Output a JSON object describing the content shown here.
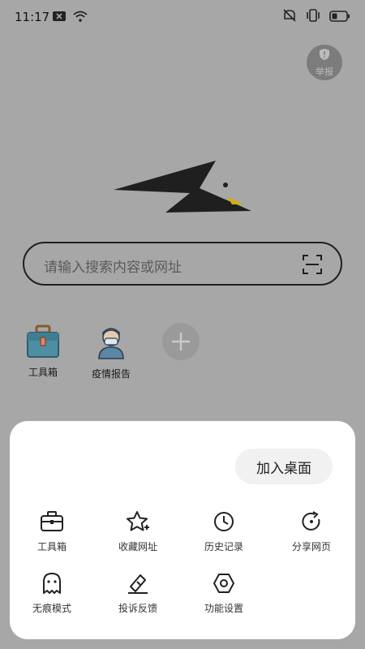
{
  "status": {
    "time": "11:17",
    "icons": [
      "notification-x-icon",
      "wifi-icon",
      "mute-icon",
      "vibrate-icon",
      "battery-icon"
    ]
  },
  "report": {
    "label": "举报",
    "icon": "report-shield-icon"
  },
  "search": {
    "placeholder": "请输入搜索内容或网址",
    "icon": "scan-icon"
  },
  "shortcuts": [
    {
      "label": "工具箱",
      "icon": "toolbox-icon"
    },
    {
      "label": "疫情报告",
      "icon": "doctor-avatar-icon"
    },
    {
      "label": "",
      "icon": "plus-icon"
    }
  ],
  "sheet": {
    "add_to_desktop": "加入桌面",
    "items": [
      {
        "label": "工具箱",
        "icon": "toolbox-icon"
      },
      {
        "label": "收藏网址",
        "icon": "star-plus-icon"
      },
      {
        "label": "历史记录",
        "icon": "clock-icon"
      },
      {
        "label": "分享网页",
        "icon": "refresh-share-icon"
      },
      {
        "label": "无痕模式",
        "icon": "ghost-icon"
      },
      {
        "label": "投诉反馈",
        "icon": "pen-feedback-icon"
      },
      {
        "label": "功能设置",
        "icon": "settings-hexagon-icon"
      }
    ]
  },
  "colors": {
    "overlay": "#a7a7a7",
    "sheet": "#ffffff",
    "accent": "#e0b400"
  }
}
